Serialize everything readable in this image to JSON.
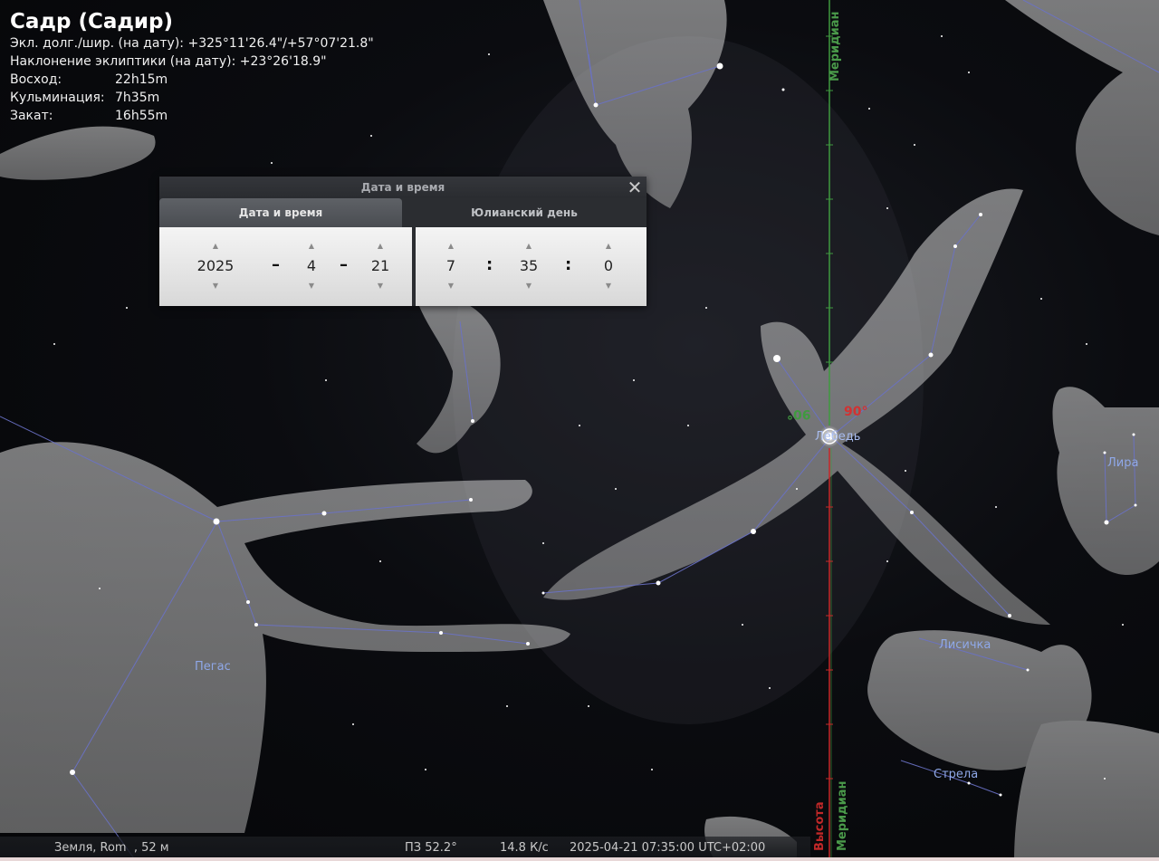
{
  "object_info": {
    "title": "Садр (Садир)",
    "lines": [
      {
        "key": "Экл. долг./шир. (на дату):",
        "value": "+325°11'26.4\"/+57°07'21.8\""
      },
      {
        "key": "Наклонение эклиптики (на дату):",
        "value": "+23°26'18.9\""
      },
      {
        "key": "Восход:",
        "value": "22h15m"
      },
      {
        "key": "Кульминация:",
        "value": "7h35m"
      },
      {
        "key": "Закат:",
        "value": "16h55m"
      }
    ]
  },
  "dialog": {
    "title": "Дата и время",
    "close_glyph": "✕",
    "tabs": [
      {
        "label": "Дата и время",
        "active": true
      },
      {
        "label": "Юлианский день",
        "active": false
      }
    ],
    "date": {
      "year": "2025",
      "month": "4",
      "day": "21",
      "separator": "–"
    },
    "time": {
      "hour": "7",
      "minute": "35",
      "second": "0",
      "separator": ":"
    }
  },
  "sky": {
    "constellations": [
      "Пегас",
      "Лебедь",
      "Лира",
      "Лисичка",
      "Стрела"
    ],
    "meridian_label": "Меридиан",
    "altitude_label": "Высота",
    "angle_green": "90°",
    "angle_red": "90°"
  },
  "status_bar": {
    "location": "Земля, Rom  , 52 м",
    "fov": "ПЗ 52.2°",
    "fps": "14.8 К/с",
    "datetime": "2025-04-21 07:35:00 UTC+02:00"
  },
  "colors": {
    "constellation_line": "#6a72c8",
    "meridian": "#3f9a3f",
    "altitude": "#c82828",
    "label": "#8fa8e8"
  },
  "icons": {
    "close": "close-icon",
    "spin_up": "triangle-up-icon",
    "spin_down": "triangle-down-icon"
  }
}
